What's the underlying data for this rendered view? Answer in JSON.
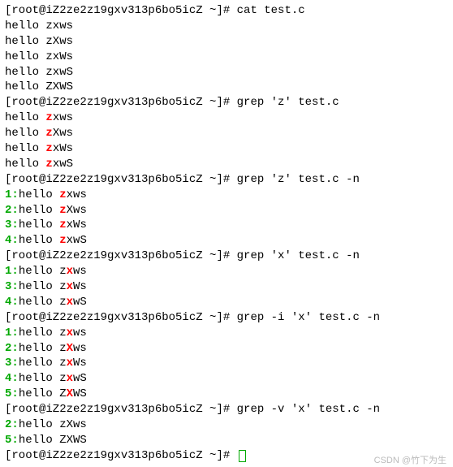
{
  "prompt": "[root@iZ2ze2z19gxv313p6bo5icZ ~]# ",
  "cmds": {
    "cat": "cat test.c",
    "grep_z": "grep 'z' test.c",
    "grep_z_n": "grep 'z' test.c -n",
    "grep_x_n": "grep 'x' test.c -n",
    "grep_i_x_n": "grep -i 'x' test.c -n",
    "grep_v_x_n": "grep -v 'x' test.c -n"
  },
  "cat_out": [
    "hello zxws",
    "hello zXws",
    "hello zxWs",
    "hello zxwS",
    "hello ZXWS"
  ],
  "grep_z": [
    {
      "pre": "hello ",
      "m": "z",
      "post": "xws"
    },
    {
      "pre": "hello ",
      "m": "z",
      "post": "Xws"
    },
    {
      "pre": "hello ",
      "m": "z",
      "post": "xWs"
    },
    {
      "pre": "hello ",
      "m": "z",
      "post": "xwS"
    }
  ],
  "grep_z_n": [
    {
      "n": "1",
      "pre": "hello ",
      "m": "z",
      "post": "xws"
    },
    {
      "n": "2",
      "pre": "hello ",
      "m": "z",
      "post": "Xws"
    },
    {
      "n": "3",
      "pre": "hello ",
      "m": "z",
      "post": "xWs"
    },
    {
      "n": "4",
      "pre": "hello ",
      "m": "z",
      "post": "xwS"
    }
  ],
  "grep_x_n": [
    {
      "n": "1",
      "pre": "hello z",
      "m": "x",
      "post": "ws"
    },
    {
      "n": "3",
      "pre": "hello z",
      "m": "x",
      "post": "Ws"
    },
    {
      "n": "4",
      "pre": "hello z",
      "m": "x",
      "post": "wS"
    }
  ],
  "grep_i_x_n": [
    {
      "n": "1",
      "pre": "hello z",
      "m": "x",
      "post": "ws"
    },
    {
      "n": "2",
      "pre": "hello z",
      "m": "X",
      "post": "ws"
    },
    {
      "n": "3",
      "pre": "hello z",
      "m": "x",
      "post": "Ws"
    },
    {
      "n": "4",
      "pre": "hello z",
      "m": "x",
      "post": "wS"
    },
    {
      "n": "5",
      "pre": "hello Z",
      "m": "X",
      "post": "WS"
    }
  ],
  "grep_v_x_n": [
    {
      "n": "2",
      "text": "hello zXws"
    },
    {
      "n": "5",
      "text": "hello ZXWS"
    }
  ],
  "watermark": "CSDN @竹下为生"
}
